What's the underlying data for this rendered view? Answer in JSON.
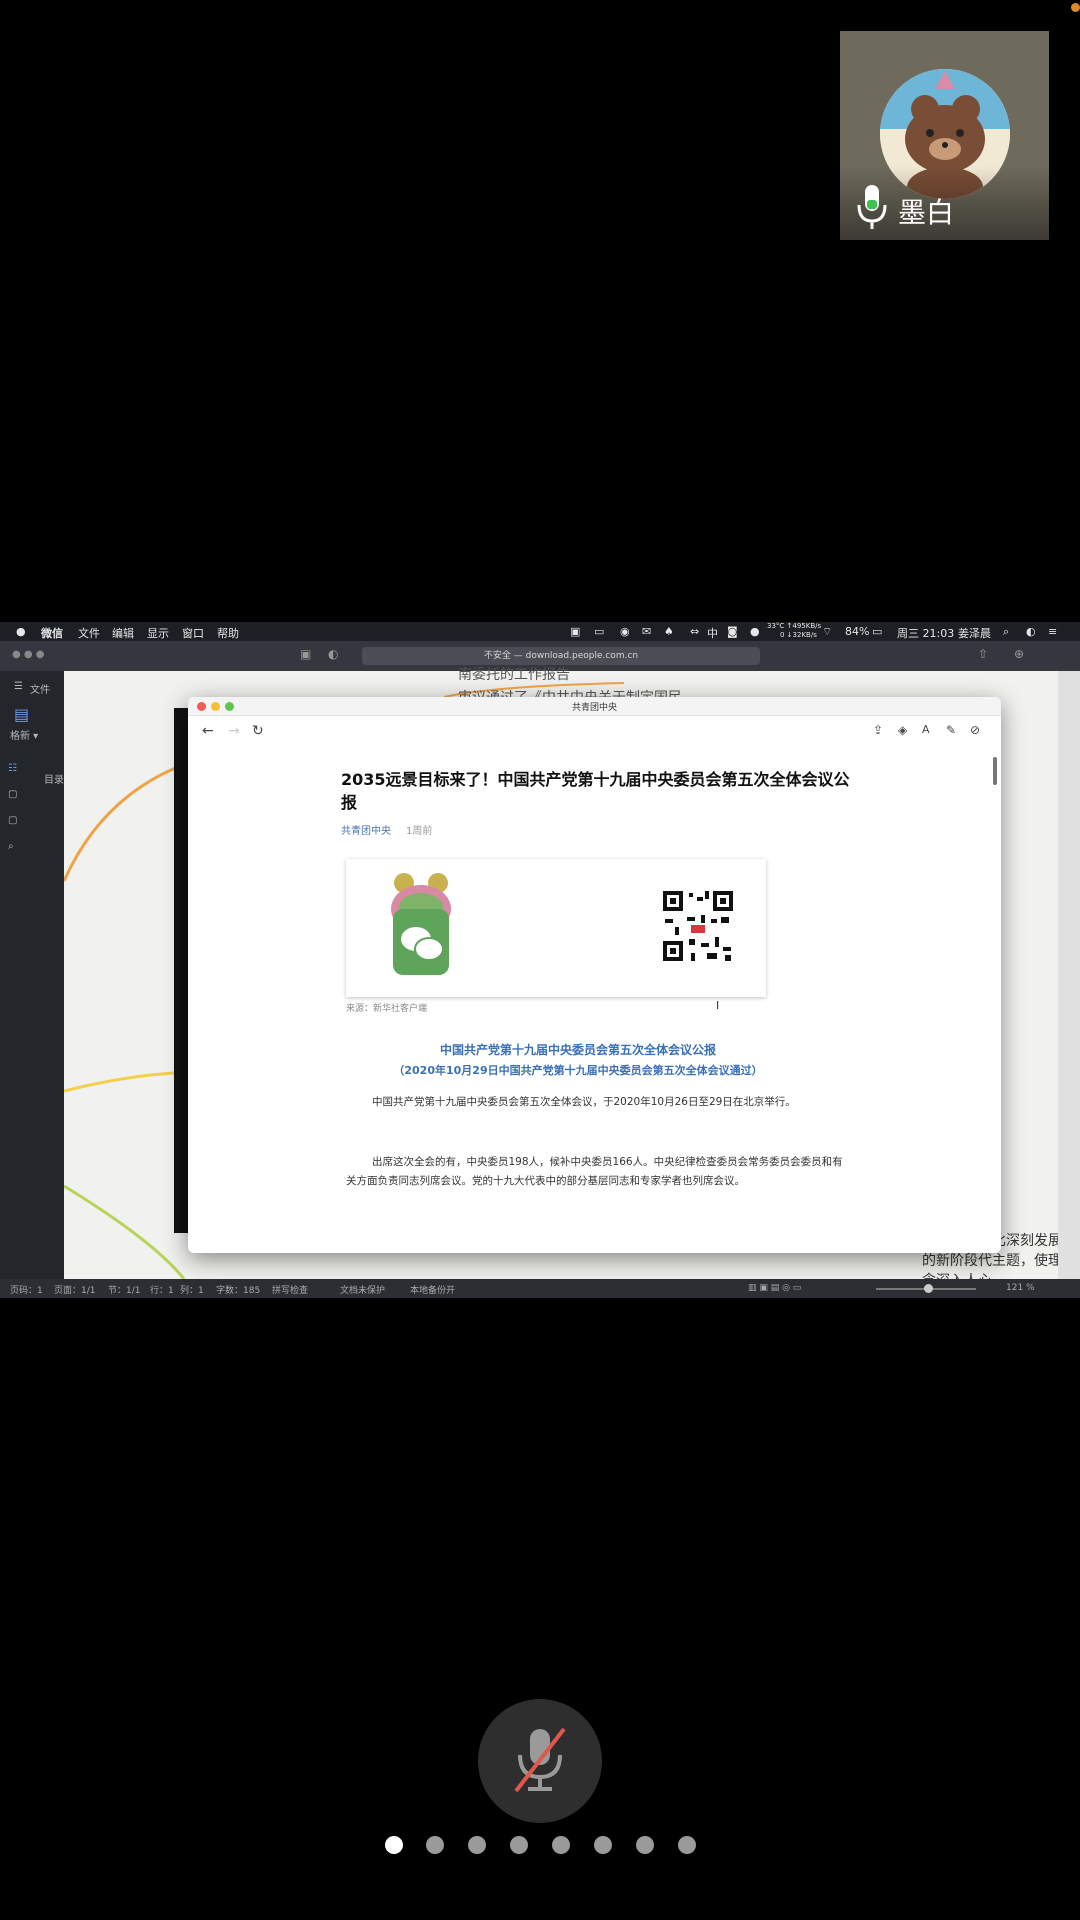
{
  "participant": {
    "name": "墨白",
    "mic": "mic-on-icon"
  },
  "menubar": {
    "apple": "",
    "items": [
      "微信",
      "文件",
      "编辑",
      "显示",
      "窗口",
      "帮助"
    ],
    "network": "33°C ↑495KB/s",
    "network2": "0  ↓32KB/s",
    "battery": "84%",
    "clock": "周三 21:03",
    "user": "姜泽晨",
    "input_method": "中"
  },
  "background_browser": {
    "url_text": "不安全 — download.people.com.cn"
  },
  "left_app": {
    "file_label": "文件",
    "tool_label": "格新 ▾",
    "section": "目录"
  },
  "mindmap": {
    "top_text1": "南委托的工作报告",
    "top_text2": "审议通过了《中共中央关于制定国民",
    "side_text": "命和产业对比深刻发展的新阶段代主题，使理念深入人心"
  },
  "statusbar": {
    "items": [
      "页码：1",
      "页面：1/1",
      "节：1/1",
      "行：1",
      "列：1",
      "字数：185",
      "拼写检查",
      "文档未保护",
      "本地备份开"
    ],
    "zoom": "121 %"
  },
  "window": {
    "title": "共青团中央",
    "article": {
      "title": "2035远景目标来了！中国共产党第十九届中央委员会第五次全体会议公报",
      "author": "共青团中央",
      "time": "1周前",
      "caption": "来源：新华社客户端",
      "heading": "中国共产党第十九届中央委员会第五次全体会议公报",
      "subheading": "（2020年10月29日中国共产党第十九届中央委员会第五次全体会议通过）",
      "para1": "中国共产党第十九届中央委员会第五次全体会议，于2020年10月26日至29日在北京举行。",
      "para2": "出席这次全会的有，中央委员198人，候补中央委员166人。中央纪律检查委员会常务委员会委员和有关方面负责同志列席会议。党的十九大代表中的部分基层同志和专家学者也列席会议。"
    }
  },
  "controls": {
    "mute": "mic-off-icon",
    "pages": 8,
    "active_page": 1
  },
  "colors": {
    "accent_blue": "#3a70b6",
    "wechat_green": "#5ea45a",
    "status_orange": "#e08b2a"
  }
}
